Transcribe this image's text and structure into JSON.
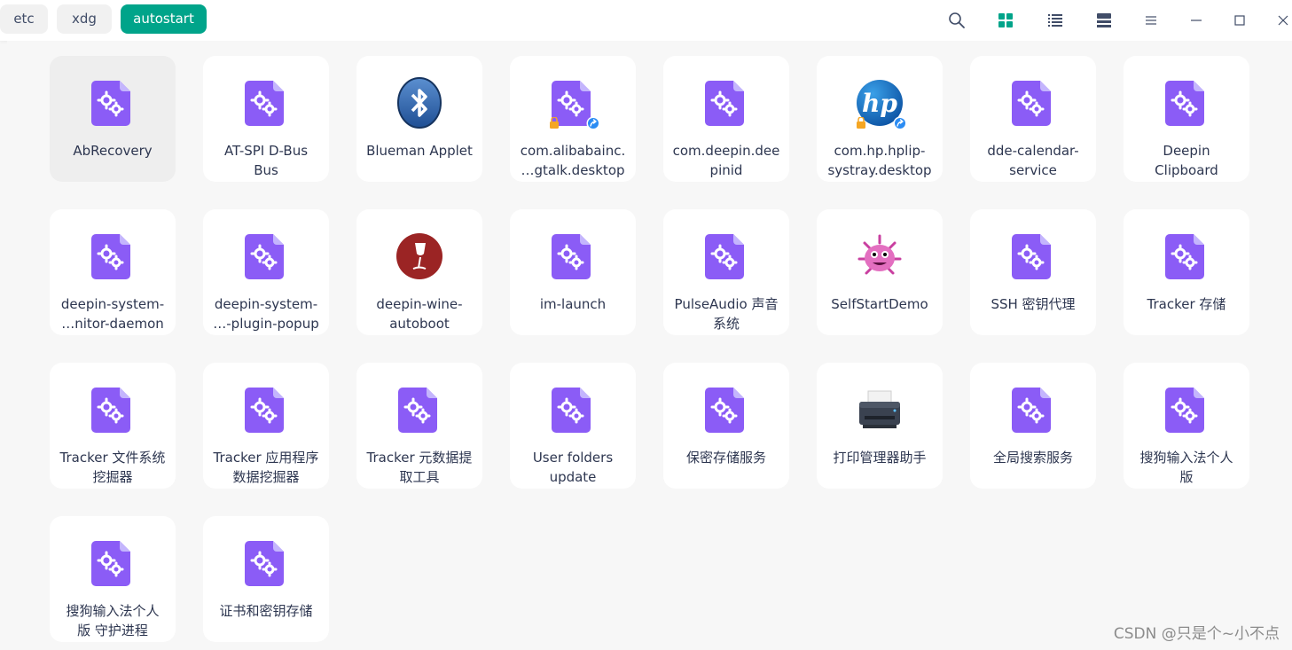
{
  "breadcrumbs": [
    "etc",
    "xdg",
    "autostart"
  ],
  "colors": {
    "accent": "#00a48a",
    "purple_file": "#8b5cf6"
  },
  "toolbar": {
    "icons": [
      "search-icon",
      "icon-view-icon",
      "list-view-icon",
      "split-view-icon",
      "menu-icon",
      "minimize-icon",
      "maximize-icon",
      "close-icon"
    ]
  },
  "items": [
    {
      "name": "AbRecovery",
      "icon": "app-settings-icon",
      "selected": true
    },
    {
      "name": "AT-SPI D-Bus\nBus",
      "icon": "app-settings-icon"
    },
    {
      "name": "Blueman Applet",
      "icon": "bluetooth-icon"
    },
    {
      "name": "com.alibabainc.\n…gtalk.desktop",
      "icon": "app-settings-icon",
      "badges": [
        "lock",
        "link"
      ]
    },
    {
      "name": "com.deepin.dee\npinid",
      "icon": "app-settings-icon"
    },
    {
      "name": "com.hp.hplip-\nsystray.desktop",
      "icon": "hp-logo-icon",
      "badges": [
        "lock",
        "link"
      ]
    },
    {
      "name": "dde-calendar-\nservice",
      "icon": "app-settings-icon"
    },
    {
      "name": "Deepin\nClipboard",
      "icon": "app-settings-icon"
    },
    {
      "name": "deepin-system-\n…nitor-daemon",
      "icon": "app-settings-icon"
    },
    {
      "name": "deepin-system-\n…-plugin-popup",
      "icon": "app-settings-icon"
    },
    {
      "name": "deepin-wine-\nautoboot",
      "icon": "wine-glass-icon"
    },
    {
      "name": "im-launch",
      "icon": "app-settings-icon"
    },
    {
      "name": "PulseAudio 声音\n系统",
      "icon": "app-settings-icon"
    },
    {
      "name": "SelfStartDemo",
      "icon": "virus-monster-icon"
    },
    {
      "name": "SSH 密钥代理",
      "icon": "app-settings-icon"
    },
    {
      "name": "Tracker 存储",
      "icon": "app-settings-icon"
    },
    {
      "name": "Tracker 文件系统\n挖掘器",
      "icon": "app-settings-icon"
    },
    {
      "name": "Tracker 应用程序\n数据挖掘器",
      "icon": "app-settings-icon"
    },
    {
      "name": "Tracker 元数据提\n取工具",
      "icon": "app-settings-icon"
    },
    {
      "name": "User folders\nupdate",
      "icon": "app-settings-icon"
    },
    {
      "name": "保密存储服务",
      "icon": "app-settings-icon"
    },
    {
      "name": "打印管理器助手",
      "icon": "printer-icon"
    },
    {
      "name": "全局搜索服务",
      "icon": "app-settings-icon"
    },
    {
      "name": "搜狗输入法个人\n版",
      "icon": "app-settings-icon"
    },
    {
      "name": "搜狗输入法个人\n版 守护进程",
      "icon": "app-settings-icon"
    },
    {
      "name": "证书和密钥存储",
      "icon": "app-settings-icon"
    }
  ],
  "watermark": "CSDN @只是个~小不点"
}
